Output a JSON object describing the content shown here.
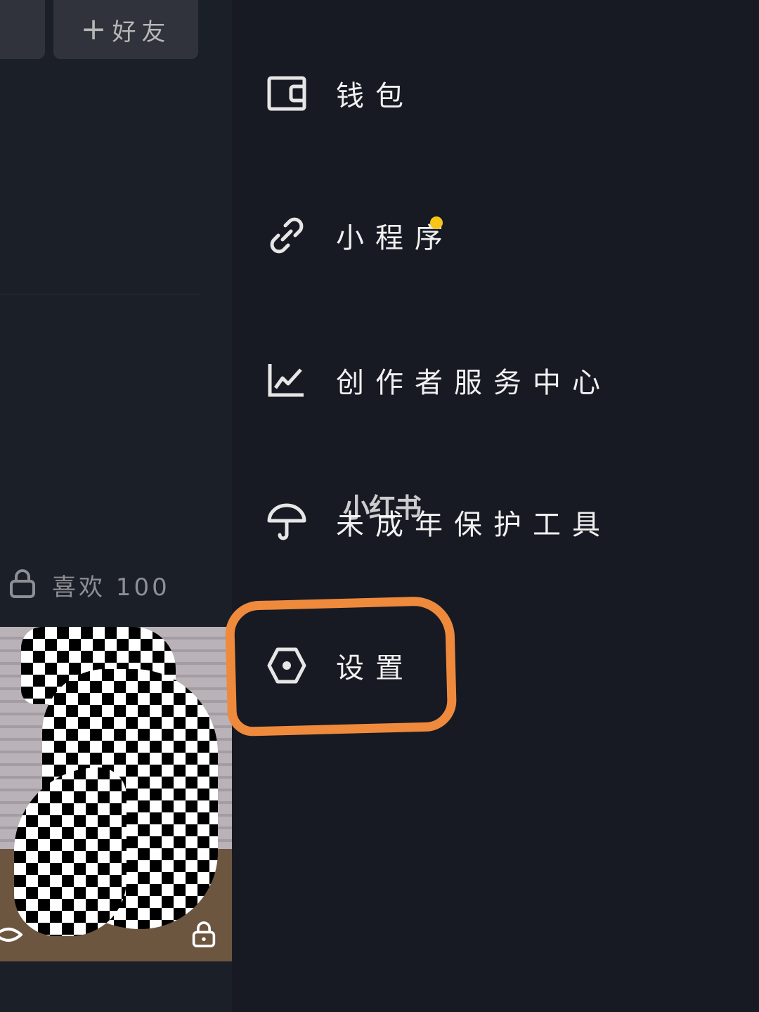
{
  "profile": {
    "add_friend_label": "好友",
    "likes_label": "喜欢 100"
  },
  "drawer": {
    "items": [
      {
        "label": "钱包",
        "icon": "wallet-icon"
      },
      {
        "label": "小程序",
        "icon": "link-icon",
        "has_dot": true
      },
      {
        "label": "创作者服务中心",
        "icon": "chart-line-icon"
      },
      {
        "label": "未成年保护工具",
        "icon": "umbrella-icon"
      },
      {
        "label": "设置",
        "icon": "hexagon-settings-icon"
      }
    ],
    "dot_color": "#f5c518"
  },
  "watermark": "小红书",
  "annotation": {
    "color": "#ef8a3d",
    "target": "设置"
  }
}
